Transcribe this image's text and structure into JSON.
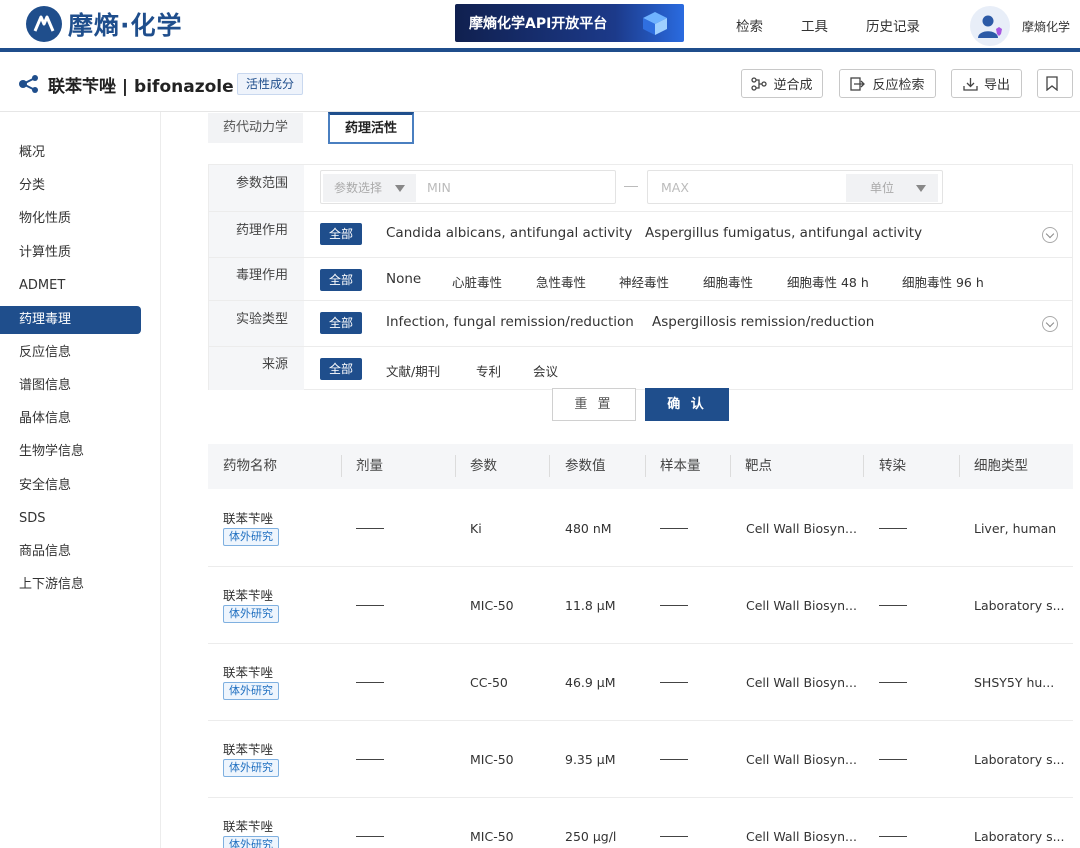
{
  "header": {
    "logo_text": "摩熵·化学",
    "api_banner": "摩熵化学API开放平台",
    "nav": [
      "检索",
      "工具",
      "历史记录"
    ],
    "user_name": "摩熵化学"
  },
  "compound": {
    "title": "联苯苄唑 | bifonazole",
    "tag": "活性成分",
    "actions": [
      "逆合成",
      "反应检索",
      "导出"
    ]
  },
  "sidebar": {
    "items": [
      "概况",
      "分类",
      "物化性质",
      "计算性质",
      "ADMET",
      "药理毒理",
      "反应信息",
      "谱图信息",
      "晶体信息",
      "生物学信息",
      "安全信息",
      "SDS",
      "商品信息",
      "上下游信息"
    ],
    "active_index": 5
  },
  "tabs": [
    "药代动力学",
    "药理活性"
  ],
  "filter": {
    "param_label": "参数范围",
    "param_select": "参数选择",
    "min_placeholder": "MIN",
    "max_placeholder": "MAX",
    "unit_placeholder": "单位",
    "rows": [
      {
        "label": "药理作用",
        "all": "全部",
        "options": [
          "Candida albicans, antifungal activity",
          "Aspergillus fumigatus, antifungal activity"
        ]
      },
      {
        "label": "毒理作用",
        "all": "全部",
        "options": [
          "None",
          "心脏毒性",
          "急性毒性",
          "神经毒性",
          "细胞毒性",
          "细胞毒性 48 h",
          "细胞毒性 96 h"
        ]
      },
      {
        "label": "实验类型",
        "all": "全部",
        "options": [
          "Infection, fungal remission/reduction",
          "Aspergillosis remission/reduction"
        ]
      },
      {
        "label": "来源",
        "all": "全部",
        "options": [
          "文献/期刊",
          "专利",
          "会议"
        ]
      }
    ],
    "reset": "重 置",
    "confirm": "确 认"
  },
  "table": {
    "columns": [
      "药物名称",
      "剂量",
      "参数",
      "参数值",
      "样本量",
      "靶点",
      "转染",
      "细胞类型"
    ],
    "rows": [
      {
        "name": "联苯苄唑",
        "tag": "体外研究",
        "param": "Ki",
        "value": "480 nM",
        "target": "Cell Wall Biosyn...",
        "cell": "Liver, human"
      },
      {
        "name": "联苯苄唑",
        "tag": "体外研究",
        "param": "MIC-50",
        "value": "11.8 μM",
        "target": "Cell Wall Biosyn...",
        "cell": "Laboratory s..."
      },
      {
        "name": "联苯苄唑",
        "tag": "体外研究",
        "param": "CC-50",
        "value": "46.9 μM",
        "target": "Cell Wall Biosyn...",
        "cell": "SHSY5Y hu..."
      },
      {
        "name": "联苯苄唑",
        "tag": "体外研究",
        "param": "MIC-50",
        "value": "9.35 μM",
        "target": "Cell Wall Biosyn...",
        "cell": "Laboratory s..."
      },
      {
        "name": "联苯苄唑",
        "tag": "体外研究",
        "param": "MIC-50",
        "value": "250 μg/l",
        "target": "Cell Wall Biosyn...",
        "cell": "Laboratory s..."
      }
    ]
  }
}
